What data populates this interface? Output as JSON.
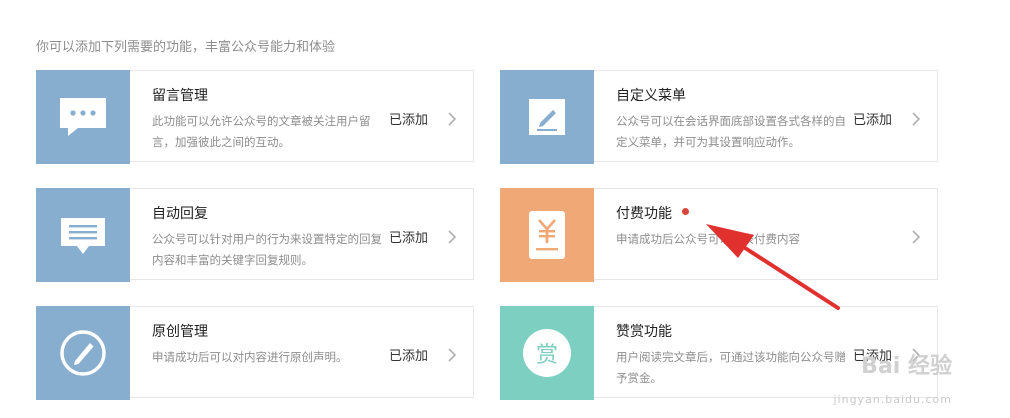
{
  "intro": "你可以添加下列需要的功能，丰富公众号能力和体验",
  "colors": {
    "blue": "#87adcf",
    "orange": "#f0a876",
    "teal": "#7dcfc1",
    "dot": "#d9463e",
    "arrow": "#e0312f"
  },
  "cards": [
    {
      "title": "留言管理",
      "desc": "此功能可以允许公众号的文章被关注用户留言，加强彼此之间的互动。",
      "status": "已添加",
      "icon": "speech-bubble-icon"
    },
    {
      "title": "自定义菜单",
      "desc": "公众号可以在会话界面底部设置各式各样的自定义菜单，并可为其设置响应动作。",
      "status": "已添加",
      "icon": "pencil-icon"
    },
    {
      "title": "自动回复",
      "desc": "公众号可以针对用户的行为来设置特定的回复内容和丰富的关键字回复规则。",
      "status": "已添加",
      "icon": "message-icon"
    },
    {
      "title": "付费功能",
      "desc": "申请成功后公众号可以发表付费内容",
      "status": "",
      "icon": "yen-icon"
    },
    {
      "title": "原创管理",
      "desc": "申请成功后可以对内容进行原创声明。",
      "status": "已添加",
      "icon": "compose-icon"
    },
    {
      "title": "赞赏功能",
      "desc": "用户阅读完文章后，可通过该功能向公众号赠予赏金。",
      "status": "已添加",
      "icon": "reward-icon",
      "icon_text": "赏"
    }
  ],
  "watermark": {
    "brand": "Bai 经验",
    "url": "jingyan.baidu.com"
  }
}
